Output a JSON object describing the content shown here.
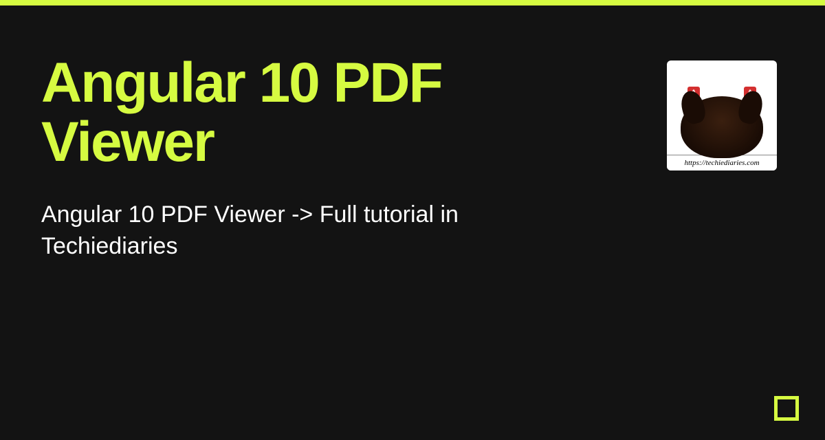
{
  "title": "Angular 10 PDF Viewer",
  "description": "Angular 10 PDF Viewer -> Full tutorial in Techiediaries",
  "avatar": {
    "badge_letter": "A",
    "link_text": "https://techiediaries.com"
  }
}
